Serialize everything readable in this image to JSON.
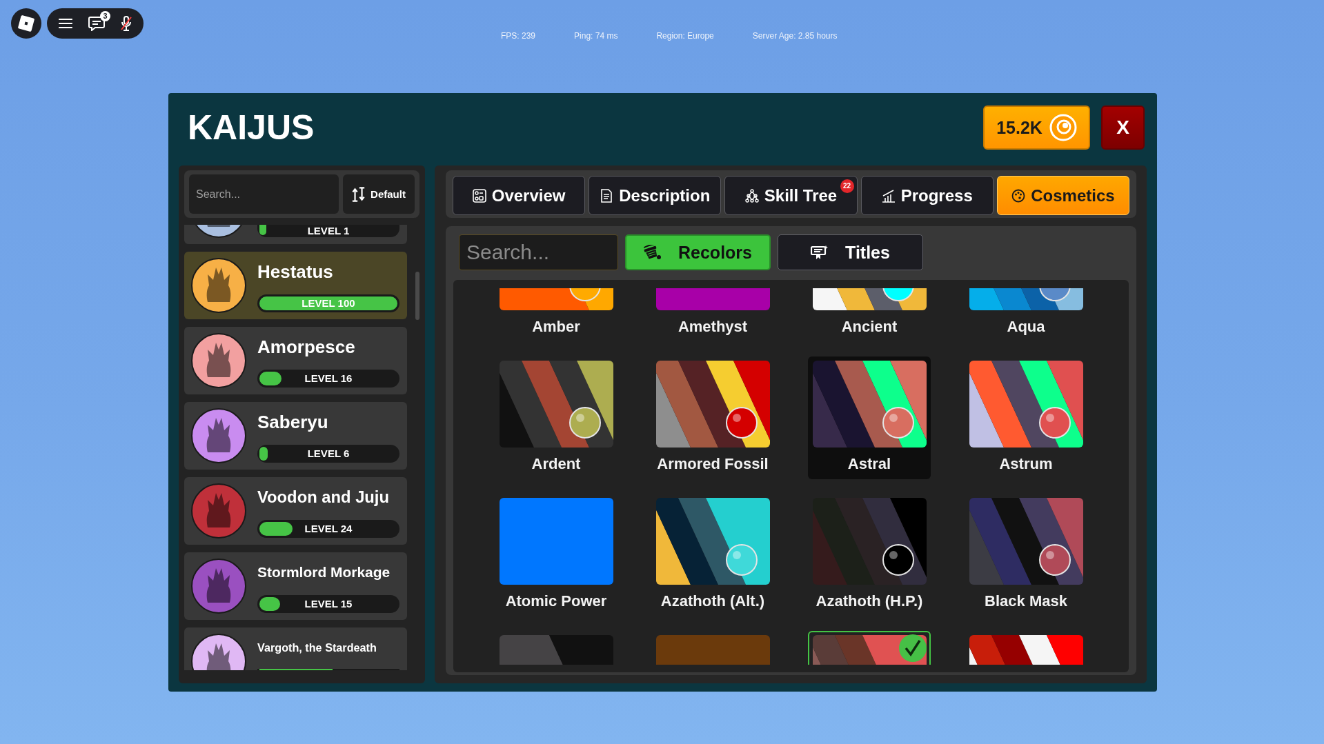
{
  "top_bar": {
    "chat_badge": "3",
    "stats": [
      "FPS: 239",
      "Ping: 74 ms",
      "Region: Europe",
      "Server Age: 2.85 hours"
    ]
  },
  "window": {
    "title": "KAIJUS",
    "currency": "15.2K",
    "close": "X"
  },
  "sidebar": {
    "search": {
      "placeholder": "Search..."
    },
    "sort": "Default",
    "kaijus": [
      {
        "level_text": "LEVEL 1",
        "level": 0.01,
        "color": "#a9bfe0",
        "selected": false
      },
      {
        "name": "Hestatus",
        "level_text": "LEVEL 100",
        "level": 1,
        "color": "#f7b046",
        "selected": true
      },
      {
        "name": "Amorpesce",
        "level_text": "LEVEL 16",
        "level": 0.16,
        "color": "#f2a0a0",
        "selected": false
      },
      {
        "name": "Saberyu",
        "level_text": "LEVEL 6",
        "level": 0.06,
        "color": "#c98cf0",
        "selected": false
      },
      {
        "name": "Voodon and Juju",
        "level_text": "LEVEL 24",
        "level": 0.24,
        "color": "#c0303a",
        "selected": false
      },
      {
        "name": "Stormlord Morkage",
        "level_text": "LEVEL 15",
        "level": 0.15,
        "color": "#9a50c0",
        "selected": false
      },
      {
        "name": "Vargoth, the Stardeath",
        "level": 0.53,
        "color": "#e0b8f4",
        "selected": false
      }
    ]
  },
  "tabs": [
    {
      "kind": "overview",
      "label": "Overview",
      "selected": false
    },
    {
      "kind": "description",
      "label": "Description",
      "selected": false
    },
    {
      "kind": "skills",
      "label": "Skill Tree",
      "badge": "22",
      "selected": false
    },
    {
      "kind": "progress",
      "label": "Progress",
      "selected": false
    },
    {
      "kind": "cosmetics",
      "label": "Cosmetics",
      "selected": true
    }
  ],
  "cosmetics": {
    "search": {
      "placeholder": "Search..."
    },
    "subtabs": [
      {
        "kind": "recolors",
        "label": "Recolors",
        "selected": true
      },
      {
        "kind": "titles",
        "label": "Titles",
        "selected": false
      }
    ],
    "recolors": [
      {
        "name": "Amber",
        "stripes": [
          {
            "color": "#ff5a00"
          },
          {
            "color": "#ffa800"
          }
        ],
        "orb": {
          "color": "#ffaa00"
        },
        "selected": false,
        "equipped": false
      },
      {
        "name": "Amethyst",
        "stripes": [
          {
            "color": "#a800a8"
          }
        ],
        "selected": false,
        "equipped": false
      },
      {
        "name": "Ancient",
        "stripes": [
          {
            "color": "#f6f6f6"
          },
          {
            "color": "#f0b83a"
          },
          {
            "color": "#5c5e6a"
          },
          {
            "color": "#f0b83a"
          }
        ],
        "orb": {
          "color": "#00ffff"
        },
        "selected": false,
        "equipped": false
      },
      {
        "name": "Aqua",
        "stripes": [
          {
            "color": "#05aeea"
          },
          {
            "color": "#0a88d0"
          },
          {
            "color": "#0c62a8"
          },
          {
            "color": "#86bde0"
          }
        ],
        "orb": {
          "color": "#5a8ac8"
        },
        "selected": false,
        "equipped": false
      },
      {
        "name": "Ardent",
        "stripes": [
          {
            "color": "#111111"
          },
          {
            "color": "#333333"
          },
          {
            "color": "#a44533"
          },
          {
            "color": "#333333"
          },
          {
            "color": "#adad50"
          }
        ],
        "orb": {
          "color": "#adad50"
        },
        "selected": false,
        "equipped": false
      },
      {
        "name": "Armored Fossil",
        "stripes": [
          {
            "color": "#8e8e8e"
          },
          {
            "color": "#a25841"
          },
          {
            "color": "#552225"
          },
          {
            "color": "#f5cd30"
          },
          {
            "color": "#d40000"
          }
        ],
        "orb": {
          "color": "#d40000"
        },
        "selected": false,
        "equipped": false
      },
      {
        "name": "Astral",
        "stripes": [
          {
            "color": "#372a4a"
          },
          {
            "color": "#1a1430"
          },
          {
            "color": "#a85a4e"
          },
          {
            "color": "#0dff8c"
          },
          {
            "color": "#d86e60"
          }
        ],
        "orb": {
          "color": "#d86e60"
        },
        "selected": true,
        "equipped": false
      },
      {
        "name": "Astrum",
        "stripes": [
          {
            "color": "#c0c0e4"
          },
          {
            "color": "#ff5a30"
          },
          {
            "color": "#504660"
          },
          {
            "color": "#0dff8c"
          },
          {
            "color": "#e05050"
          }
        ],
        "orb": {
          "color": "#e05050"
        },
        "selected": false,
        "equipped": false
      },
      {
        "name": "Atomic Power",
        "stripes": [
          {
            "color": "#0077ff"
          }
        ],
        "selected": false,
        "equipped": false
      },
      {
        "name": "Azathoth (Alt.)",
        "stripes": [
          {
            "color": "#f0b83a"
          },
          {
            "color": "#062236"
          },
          {
            "color": "#2e5866"
          },
          {
            "color": "#24cfcf"
          }
        ],
        "orb": {
          "color": "#3fd9d9"
        },
        "selected": false,
        "equipped": false
      },
      {
        "name": "Azathoth (H.P.)",
        "stripes": [
          {
            "color": "#351b1c"
          },
          {
            "color": "#1c2019"
          },
          {
            "color": "#2a2224"
          },
          {
            "color": "#312d3e"
          },
          {
            "color": "#000000"
          }
        ],
        "orb": {
          "color": "#000000"
        },
        "selected": false,
        "equipped": false
      },
      {
        "name": "Black Mask",
        "stripes": [
          {
            "color": "#3c3c44"
          },
          {
            "color": "#2e2c62"
          },
          {
            "color": "#111111"
          },
          {
            "color": "#433b5e"
          },
          {
            "color": "#b04a58"
          }
        ],
        "orb": {
          "color": "#b04a58"
        },
        "selected": false,
        "equipped": false
      },
      {
        "stripes": [
          {
            "color": "#454345"
          },
          {
            "color": "#111111"
          }
        ],
        "selected": false,
        "equipped": false
      },
      {
        "stripes": [
          {
            "color": "#6b3a0c"
          }
        ],
        "selected": false,
        "equipped": false
      },
      {
        "stripes": [
          {
            "color": "#8a5a56"
          },
          {
            "color": "#5a3c38"
          },
          {
            "color": "#6a3528"
          },
          {
            "color": "#e05252"
          }
        ],
        "selected": false,
        "equipped": true
      },
      {
        "stripes": [
          {
            "color": "#f5f5f5"
          },
          {
            "color": "#c81e0a"
          },
          {
            "color": "#960000"
          },
          {
            "color": "#f5f5f5"
          },
          {
            "color": "#ff0000"
          }
        ],
        "selected": false,
        "equipped": false
      }
    ]
  }
}
